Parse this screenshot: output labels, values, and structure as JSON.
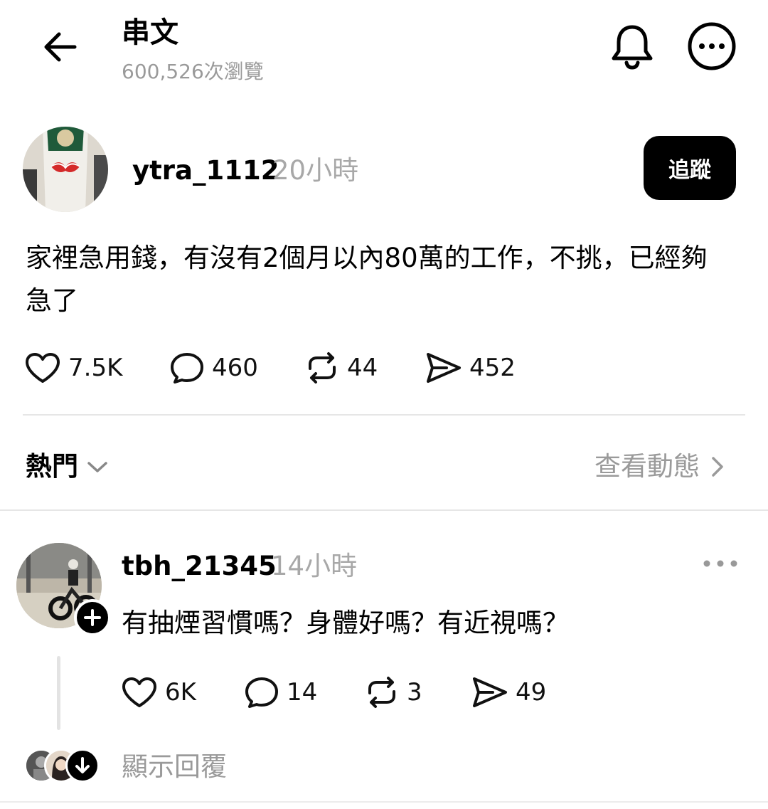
{
  "header": {
    "title": "串文",
    "views": "600,526次瀏覽"
  },
  "post": {
    "username": "ytra_1112",
    "time": "20小時",
    "follow_label": "追蹤",
    "text": "家裡急用錢，有沒有2個月以內80萬的工作，不挑，已經夠急了",
    "likes": "7.5K",
    "comments": "460",
    "reposts": "44",
    "shares": "452"
  },
  "sort": {
    "label": "熱門",
    "activity_label": "查看動態"
  },
  "comment": {
    "username": "tbh_21345",
    "time": "14小時",
    "text": "有抽煙習慣嗎？身體好嗎？有近視嗎？",
    "likes": "6K",
    "comments": "14",
    "reposts": "3",
    "shares": "49",
    "show_replies": "顯示回覆"
  },
  "icons": {
    "back": "arrow-left-icon",
    "bell": "bell-icon",
    "more": "more-circle-icon",
    "like": "heart-icon",
    "comment": "comment-bubble-icon",
    "repost": "repost-icon",
    "share": "send-icon",
    "sort": "chevron-down-icon",
    "activity": "chevron-right-icon",
    "add": "plus-icon",
    "expand": "arrow-down-icon"
  },
  "colors": {
    "primary_text": "#000000",
    "secondary_text": "#9a9a9a",
    "divider": "#e6e6e6",
    "button_bg": "#000000"
  }
}
